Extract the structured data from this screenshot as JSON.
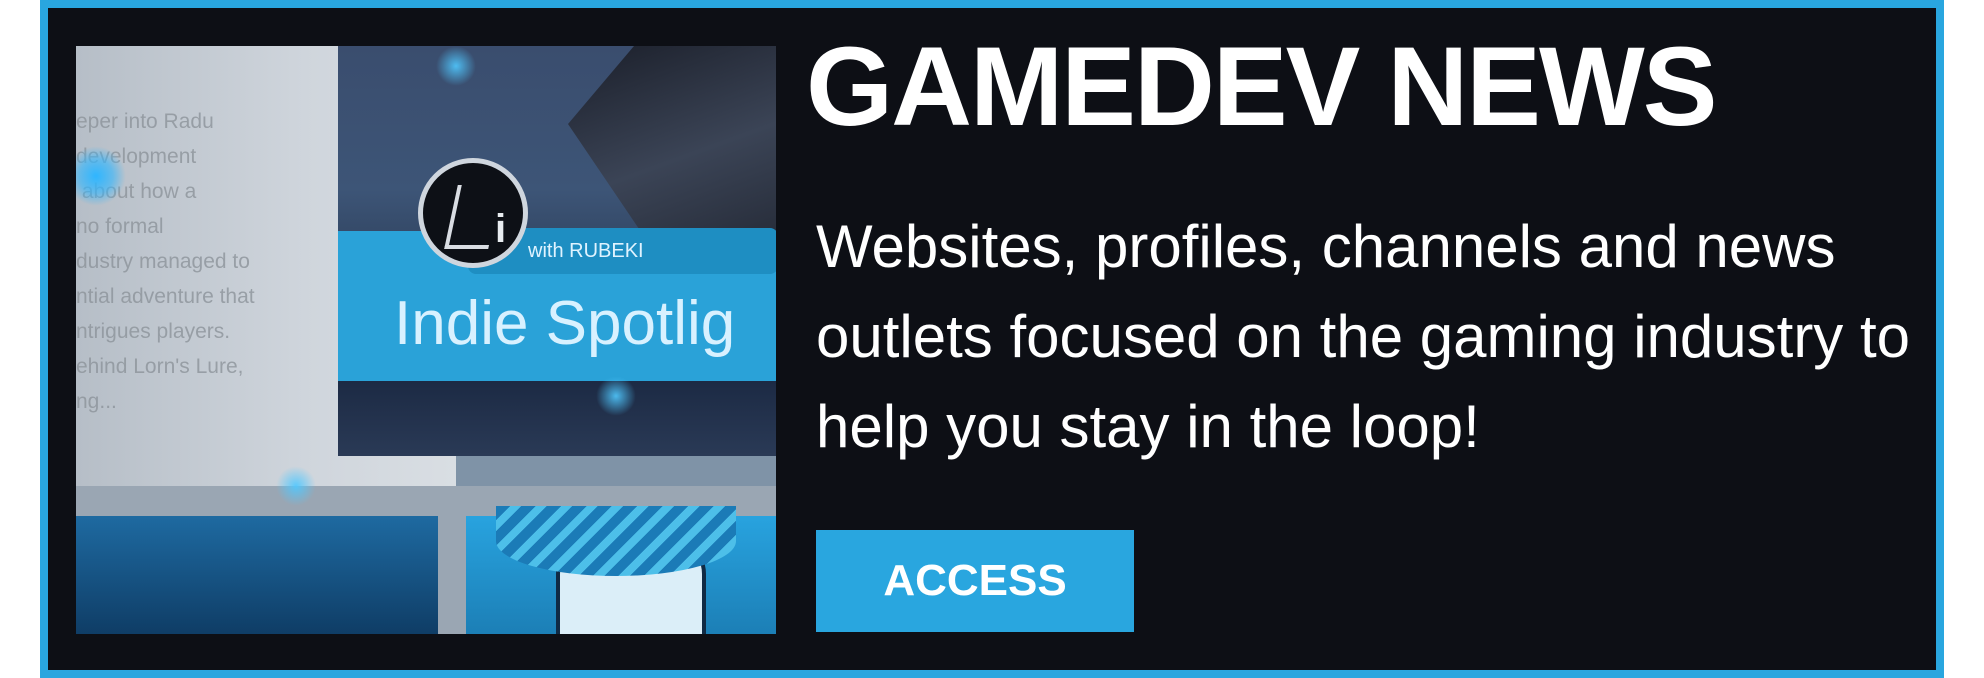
{
  "banner": {
    "title": "GAMEDEV NEWS",
    "description": "Websites, profiles, channels and news outlets focused on the gaming industry to help you stay in the loop!",
    "button_label": "ACCESS",
    "colors": {
      "accent": "#29a6df",
      "background": "#0d0f15",
      "text": "#ffffff"
    }
  },
  "thumbnail": {
    "page_text": "eper into Radu\ndevelopment\n about how a\nno formal\ndustry managed to\nntial adventure that\nntrigues players.\nehind Lorn's Lure,\nng...",
    "tag_text": "with RUBEKI",
    "spotlight_text": "Indie Spotlig",
    "logo_letter": "i"
  }
}
